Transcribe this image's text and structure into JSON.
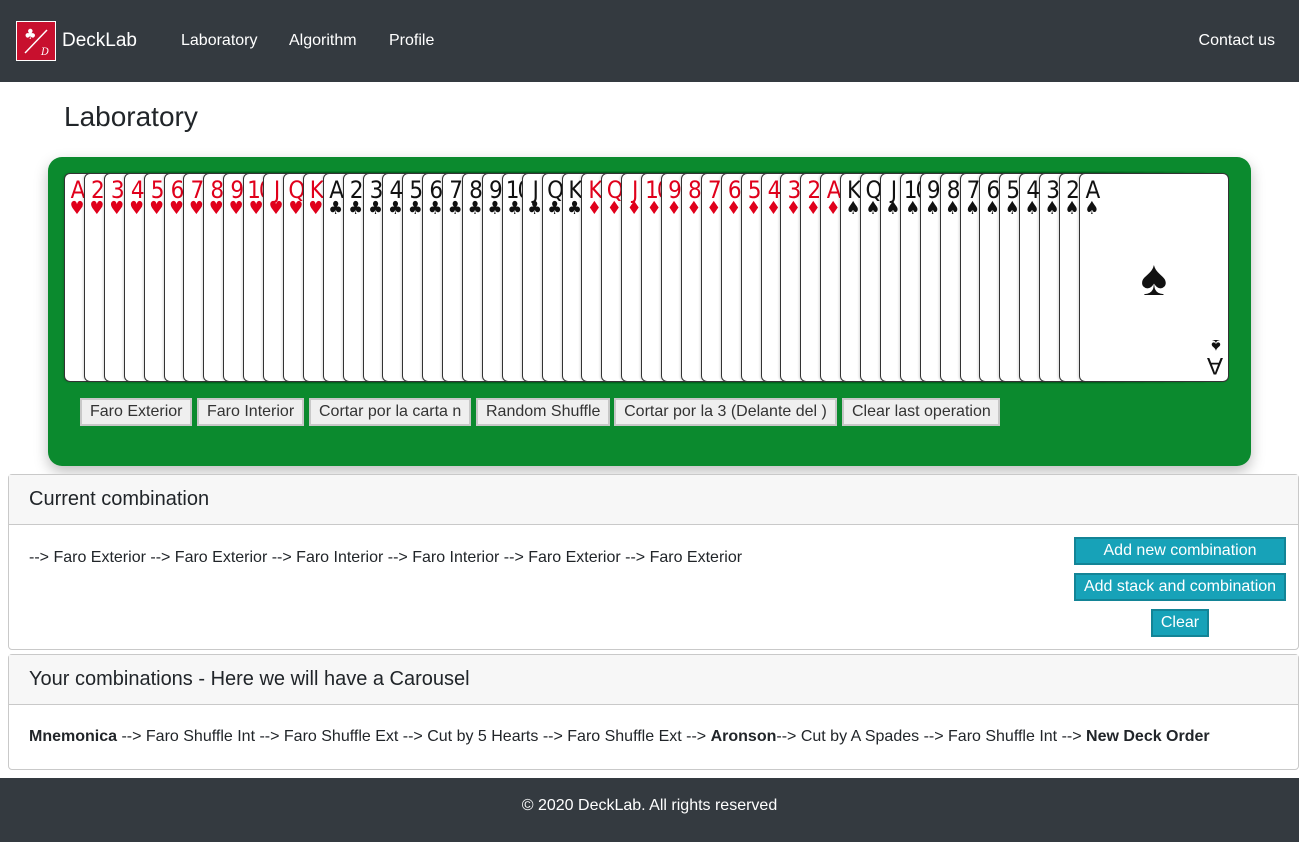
{
  "nav": {
    "brand": "DeckLab",
    "links": [
      "Laboratory",
      "Algorithm",
      "Profile"
    ],
    "contact": "Contact us"
  },
  "page": {
    "title": "Laboratory"
  },
  "deck": {
    "cards": [
      {
        "rank": "A",
        "suit": "♥",
        "color": "red"
      },
      {
        "rank": "2",
        "suit": "♥",
        "color": "red"
      },
      {
        "rank": "3",
        "suit": "♥",
        "color": "red"
      },
      {
        "rank": "4",
        "suit": "♥",
        "color": "red"
      },
      {
        "rank": "5",
        "suit": "♥",
        "color": "red"
      },
      {
        "rank": "6",
        "suit": "♥",
        "color": "red"
      },
      {
        "rank": "7",
        "suit": "♥",
        "color": "red"
      },
      {
        "rank": "8",
        "suit": "♥",
        "color": "red"
      },
      {
        "rank": "9",
        "suit": "♥",
        "color": "red"
      },
      {
        "rank": "10",
        "suit": "♥",
        "color": "red"
      },
      {
        "rank": "J",
        "suit": "♥",
        "color": "red"
      },
      {
        "rank": "Q",
        "suit": "♥",
        "color": "red"
      },
      {
        "rank": "K",
        "suit": "♥",
        "color": "red"
      },
      {
        "rank": "A",
        "suit": "♣",
        "color": "black"
      },
      {
        "rank": "2",
        "suit": "♣",
        "color": "black"
      },
      {
        "rank": "3",
        "suit": "♣",
        "color": "black"
      },
      {
        "rank": "4",
        "suit": "♣",
        "color": "black"
      },
      {
        "rank": "5",
        "suit": "♣",
        "color": "black"
      },
      {
        "rank": "6",
        "suit": "♣",
        "color": "black"
      },
      {
        "rank": "7",
        "suit": "♣",
        "color": "black"
      },
      {
        "rank": "8",
        "suit": "♣",
        "color": "black"
      },
      {
        "rank": "9",
        "suit": "♣",
        "color": "black"
      },
      {
        "rank": "10",
        "suit": "♣",
        "color": "black"
      },
      {
        "rank": "J",
        "suit": "♣",
        "color": "black"
      },
      {
        "rank": "Q",
        "suit": "♣",
        "color": "black"
      },
      {
        "rank": "K",
        "suit": "♣",
        "color": "black"
      },
      {
        "rank": "K",
        "suit": "♦",
        "color": "red"
      },
      {
        "rank": "Q",
        "suit": "♦",
        "color": "red"
      },
      {
        "rank": "J",
        "suit": "♦",
        "color": "red"
      },
      {
        "rank": "10",
        "suit": "♦",
        "color": "red"
      },
      {
        "rank": "9",
        "suit": "♦",
        "color": "red"
      },
      {
        "rank": "8",
        "suit": "♦",
        "color": "red"
      },
      {
        "rank": "7",
        "suit": "♦",
        "color": "red"
      },
      {
        "rank": "6",
        "suit": "♦",
        "color": "red"
      },
      {
        "rank": "5",
        "suit": "♦",
        "color": "red"
      },
      {
        "rank": "4",
        "suit": "♦",
        "color": "red"
      },
      {
        "rank": "3",
        "suit": "♦",
        "color": "red"
      },
      {
        "rank": "2",
        "suit": "♦",
        "color": "red"
      },
      {
        "rank": "A",
        "suit": "♦",
        "color": "red"
      },
      {
        "rank": "K",
        "suit": "♠",
        "color": "black"
      },
      {
        "rank": "Q",
        "suit": "♠",
        "color": "black"
      },
      {
        "rank": "J",
        "suit": "♠",
        "color": "black"
      },
      {
        "rank": "10",
        "suit": "♠",
        "color": "black"
      },
      {
        "rank": "9",
        "suit": "♠",
        "color": "black"
      },
      {
        "rank": "8",
        "suit": "♠",
        "color": "black"
      },
      {
        "rank": "7",
        "suit": "♠",
        "color": "black"
      },
      {
        "rank": "6",
        "suit": "♠",
        "color": "black"
      },
      {
        "rank": "5",
        "suit": "♠",
        "color": "black"
      },
      {
        "rank": "4",
        "suit": "♠",
        "color": "black"
      },
      {
        "rank": "3",
        "suit": "♠",
        "color": "black"
      },
      {
        "rank": "2",
        "suit": "♠",
        "color": "black"
      },
      {
        "rank": "A",
        "suit": "♠",
        "color": "black"
      }
    ],
    "colors": {
      "red": "#e0001b",
      "black": "#111111",
      "table": "#0b8a2e"
    }
  },
  "shuffles": [
    "Faro Exterior",
    "Faro Interior",
    "Cortar por la carta n",
    "Random Shuffle",
    "Cortar por la 3 (Delante del )",
    "Clear last operation"
  ],
  "current": {
    "header": "Current combination",
    "text": "--> Faro Exterior --> Faro Exterior --> Faro Interior --> Faro Interior --> Faro Exterior --> Faro Exterior",
    "buttons": {
      "add_new": "Add new combination",
      "add_stack": "Add stack and combination",
      "clear": "Clear"
    }
  },
  "saved": {
    "header": "Your combinations - Here we will have a Carousel",
    "start": "Mnemonica",
    "part1": " --> Faro Shuffle Int --> Faro Shuffle Ext --> Cut by 5 Hearts --> Faro Shuffle Ext --> ",
    "mid": "Aronson",
    "part2": "--> Cut by A Spades --> Faro Shuffle Int --> ",
    "end": "New Deck Order"
  },
  "footer": {
    "text": "© 2020 DeckLab. All rights reserved"
  }
}
